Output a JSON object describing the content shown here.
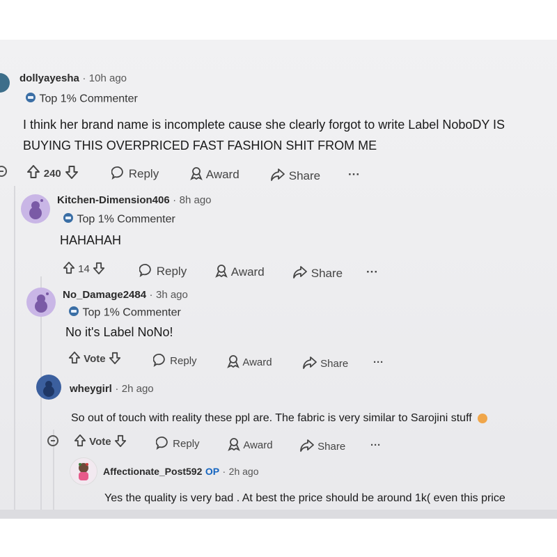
{
  "comments": [
    {
      "username": "dollyayesha",
      "time": "10h ago",
      "flair": "Top 1% Commenter",
      "body_line1": "I think her brand name is incomplete cause she clearly forgot to write Label NoboDY IS",
      "body_line2": "BUYING THIS OVERPRICED FAST FASHION SHIT FROM ME",
      "votes": "240",
      "reply": "Reply",
      "award": "Award",
      "share": "Share",
      "more": "···"
    },
    {
      "username": "Kitchen-Dimension406",
      "time": "8h ago",
      "flair": "Top 1% Commenter",
      "body": "HAHAHAH",
      "votes": "14",
      "reply": "Reply",
      "award": "Award",
      "share": "Share",
      "more": "···"
    },
    {
      "username": "No_Damage2484",
      "time": "3h ago",
      "flair": "Top 1% Commenter",
      "body": "No it's Label NoNo!",
      "votes": "Vote",
      "reply": "Reply",
      "award": "Award",
      "share": "Share",
      "more": "···"
    },
    {
      "username": "wheygirl",
      "time": "2h ago",
      "body": "So out of touch with reality these ppl are. The fabric is very similar to Sarojini stuff",
      "votes": "Vote",
      "reply": "Reply",
      "award": "Award",
      "share": "Share",
      "more": "···"
    },
    {
      "username": "Affectionate_Post592",
      "op_badge": "OP",
      "time": "2h ago",
      "body": "Yes the quality is very bad . At best the price should be around 1k( even this price"
    }
  ],
  "separator": "·",
  "colors": {
    "avatar_purple": "#c9b6e6",
    "avatar_blue": "#3b5f9e",
    "op_blue": "#1565c0"
  }
}
